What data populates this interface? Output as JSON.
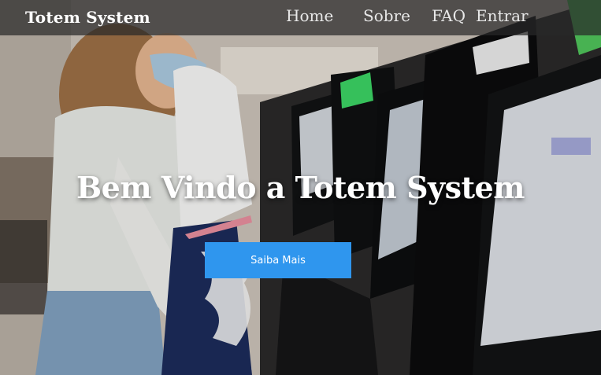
{
  "navbar": {
    "brand": "Totem System",
    "links": [
      "Home",
      "Sobre",
      "FAQ",
      "Entrar"
    ]
  },
  "hero": {
    "headline": "Bem Vindo a Totem System",
    "cta_label": "Saiba Mais",
    "background_image": "woman-with-mask-using-self-service-kiosks"
  },
  "colors": {
    "navbar_bg": "#282828",
    "cta_bg": "#2f96ee",
    "text": "#ffffff"
  }
}
